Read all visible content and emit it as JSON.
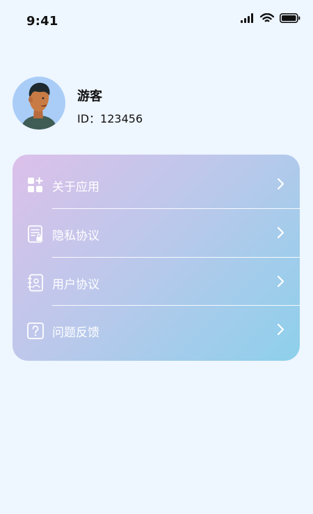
{
  "status_bar": {
    "time": "9:41",
    "icons": [
      "signal-icon",
      "wifi-icon",
      "battery-icon"
    ]
  },
  "profile": {
    "name": "游客",
    "id_label": "ID：123456"
  },
  "menu": {
    "items": [
      {
        "label": "关于应用",
        "icon": "apps-icon"
      },
      {
        "label": "隐私协议",
        "icon": "document-lock-icon"
      },
      {
        "label": "用户协议",
        "icon": "contact-book-icon"
      },
      {
        "label": "问题反馈",
        "icon": "question-icon"
      }
    ]
  },
  "colors": {
    "background": "#eef6ff",
    "card_gradient_start": "#dcc0ea",
    "card_gradient_mid": "#bcc8eb",
    "card_gradient_end": "#8dd0eb",
    "menu_text": "#ffffff"
  }
}
